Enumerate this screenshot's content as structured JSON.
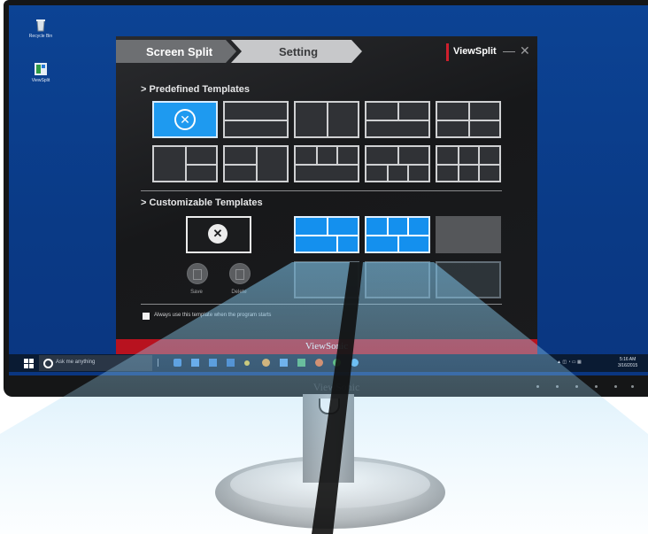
{
  "desktop": {
    "icons": [
      {
        "label": "Recycle Bin",
        "icon": "recycle-bin-icon"
      },
      {
        "label": "ViewSplit",
        "icon": "viewsplit-shortcut-icon"
      }
    ]
  },
  "app": {
    "tabs": [
      {
        "label": "Screen Split",
        "active": false
      },
      {
        "label": "Setting",
        "active": true
      }
    ],
    "brand": "ViewSplit",
    "window_controls": {
      "minimize": "—",
      "close": "✕"
    },
    "sections": {
      "predefined_title": "Predefined Templates",
      "customizable_title": "Customizable Templates"
    },
    "custom_buttons": {
      "save": "Save",
      "delete": "Delete"
    },
    "always_use_label": "Always use this template when the program starts",
    "footer_brand": "ViewSonic"
  },
  "taskbar": {
    "search_placeholder": "Ask me anything",
    "clock_time": "5:16 AM",
    "clock_date": "3/16/2015"
  },
  "monitor": {
    "brand": "ViewSonic"
  },
  "colors": {
    "accent_blue": "#1e9af0",
    "brand_red": "#b8121f",
    "desktop_blue": "#0b3f8e"
  }
}
